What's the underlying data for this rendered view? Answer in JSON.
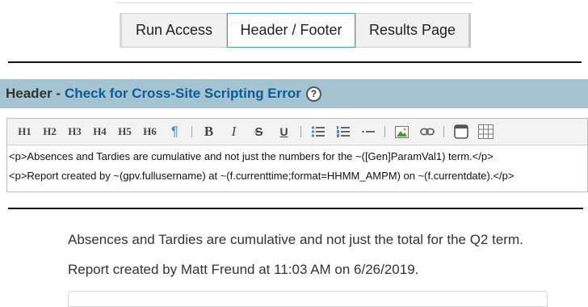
{
  "tabs": [
    {
      "label": "Run Access",
      "active": false
    },
    {
      "label": "Header / Footer",
      "active": true
    },
    {
      "label": "Results Page",
      "active": false
    }
  ],
  "section": {
    "label": "Header -",
    "link": "Check for Cross-Site Scripting Error",
    "help": "?"
  },
  "toolbar": {
    "headings": [
      "H1",
      "H2",
      "H3",
      "H4",
      "H5",
      "H6"
    ],
    "paragraph": "¶",
    "bold": "B",
    "italic": "I",
    "strike": "S",
    "underline": "U"
  },
  "editor": {
    "lines": [
      "<p>Absences and Tardies are cumulative and not just the numbers for the ~([Gen]ParamVal1) term.</p>",
      "<p>Report created by ~(gpv.fullusername) at ~(f.currenttime;format=HHMM_AMPM) on ~(f.currentdate).</p>"
    ]
  },
  "preview": {
    "lines": [
      "Absences and Tardies are cumulative and not just the total for the Q2 term.",
      "Report created by Matt Freund at 11:03 AM on 6/26/2019."
    ]
  },
  "colors": {
    "header_bar": "#a4c4d2",
    "link": "#0d5c97",
    "active_tab_border": "#4a9bb5"
  }
}
